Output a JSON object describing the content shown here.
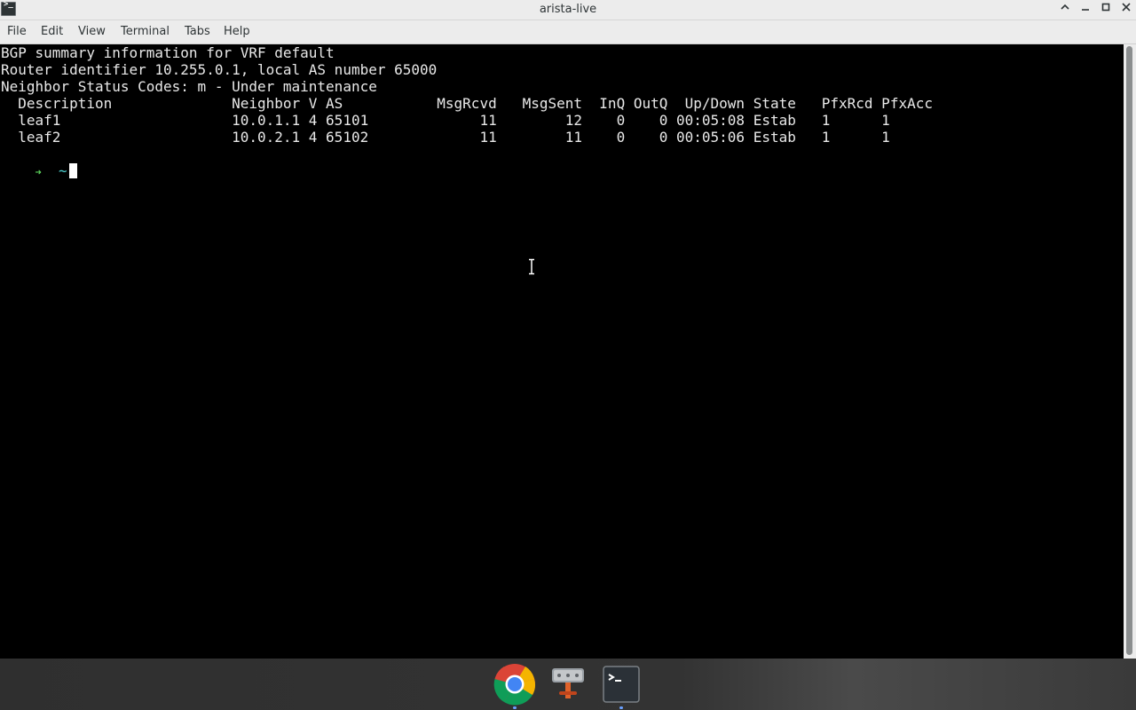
{
  "window": {
    "title": "arista-live"
  },
  "menu": {
    "items": [
      "File",
      "Edit",
      "View",
      "Terminal",
      "Tabs",
      "Help"
    ]
  },
  "terminal": {
    "lines": [
      "BGP summary information for VRF default",
      "Router identifier 10.255.0.1, local AS number 65000",
      "Neighbor Status Codes: m - Under maintenance",
      "  Description              Neighbor V AS           MsgRcvd   MsgSent  InQ OutQ  Up/Down State   PfxRcd PfxAcc",
      "  leaf1                    10.0.1.1 4 65101             11        12    0    0 00:05:08 Estab   1      1",
      "  leaf2                    10.0.2.1 4 65102             11        11    0    0 00:05:06 Estab   1      1"
    ],
    "prompt": {
      "arrow": "➜",
      "cwd": "~"
    }
  },
  "taskbar": {
    "apps": [
      "chrome-icon",
      "network-tool-icon",
      "terminal-icon"
    ]
  },
  "colors": {
    "prompt_arrow": "#5cd35c",
    "prompt_cwd": "#4fd4d4",
    "terminal_bg": "#000000",
    "terminal_fg": "#e8e8e8"
  }
}
